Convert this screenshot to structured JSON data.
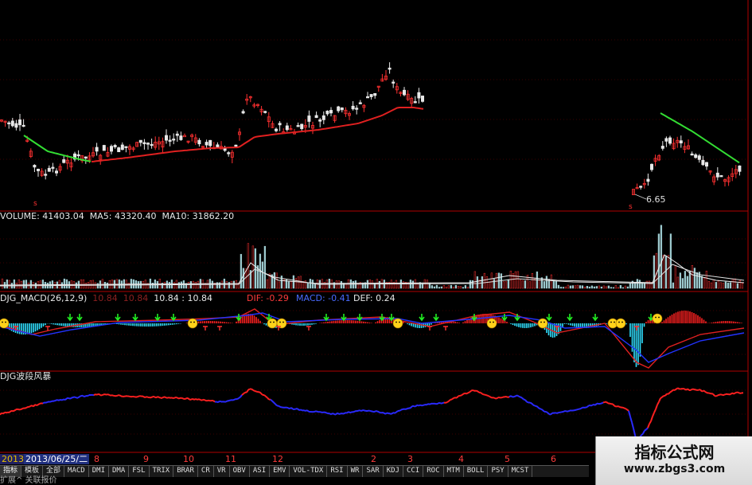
{
  "volume_header": {
    "volume": "VOLUME: 41403.04",
    "ma5": "MA5: 43320.40",
    "ma10": "MA10: 31862.20"
  },
  "macd_header": {
    "name": "DJG_MACD(26,12,9)",
    "v1": "10.84",
    "v2": "10.84",
    "v3": "10.84 : 10.84",
    "dif": "DIF: -0.29",
    "macd": "MACD: -0.41",
    "def": "DEF: 0.24"
  },
  "wave_header": {
    "name": "DJG波段风暴"
  },
  "price_note": "6.65",
  "date_bar": {
    "year": "2013",
    "date": "2013/06/25/二",
    "ticks": [
      "8",
      "9",
      "10",
      "11",
      "12",
      "2",
      "3",
      "4",
      "5",
      "6"
    ]
  },
  "tabs": [
    "指标",
    "模板",
    "全部",
    "MACD",
    "DMI",
    "DMA",
    "FSL",
    "TRIX",
    "BRAR",
    "CR",
    "VR",
    "OBV",
    "ASI",
    "EMV",
    "VOL-TDX",
    "RSI",
    "WR",
    "SAR",
    "KDJ",
    "CCI",
    "ROC",
    "MTM",
    "BOLL",
    "PSY",
    "MCST"
  ],
  "bottom_text": "扩展^ 关联报价",
  "watermark": {
    "title": "指标公式网",
    "url": "www.zbgs3.com"
  },
  "colors": {
    "up": "#ff2a2a",
    "down": "#2de0e0",
    "ma_long": "#e02020",
    "ma_green": "#33dd33",
    "grid": "#7a0000",
    "macd_blue": "#2233ff"
  },
  "chart_data": [
    {
      "type": "candlestick",
      "panel": "price",
      "annotation": "6.65",
      "note": "price panel, two segments of data with gap"
    },
    {
      "type": "bar",
      "panel": "volume",
      "series": [
        {
          "name": "VOLUME",
          "last": 41403.04
        },
        {
          "name": "MA5",
          "last": 43320.4
        },
        {
          "name": "MA10",
          "last": 31862.2
        }
      ]
    },
    {
      "type": "bar",
      "panel": "macd",
      "title": "DJG_MACD(26,12,9)",
      "series": [
        {
          "name": "DIF",
          "last": -0.29
        },
        {
          "name": "MACD",
          "last": -0.41
        },
        {
          "name": "DEF",
          "last": 0.24
        }
      ]
    },
    {
      "type": "line",
      "panel": "wave",
      "title": "DJG波段风暴"
    }
  ]
}
